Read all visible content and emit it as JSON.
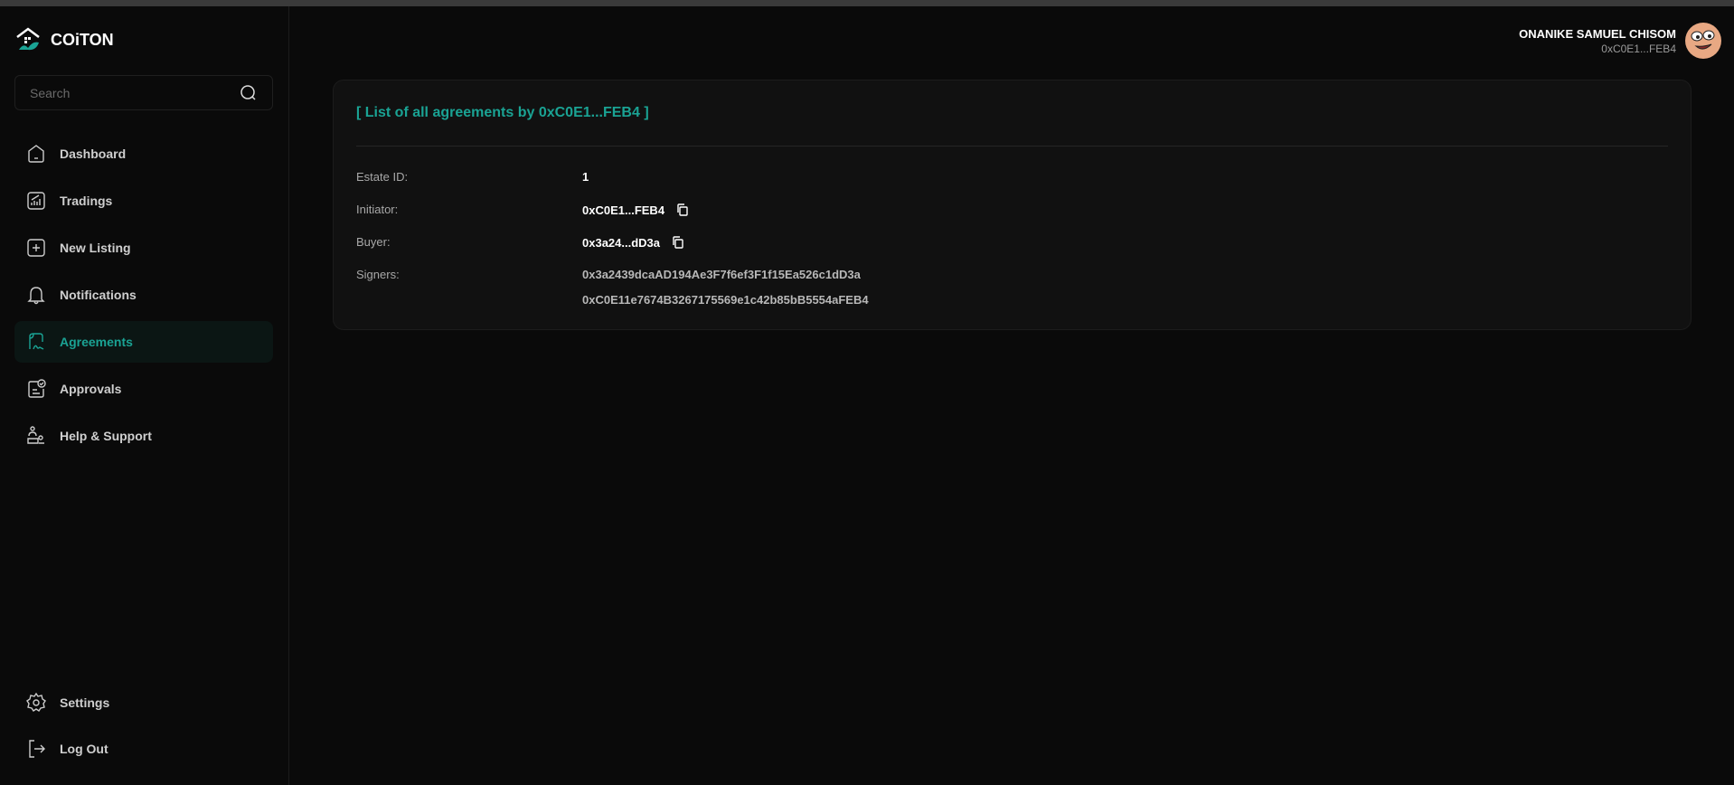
{
  "app": {
    "name": "COiTON"
  },
  "search": {
    "placeholder": "Search"
  },
  "nav": [
    {
      "label": "Dashboard",
      "icon": "home-icon"
    },
    {
      "label": "Tradings",
      "icon": "chart-icon"
    },
    {
      "label": "New Listing",
      "icon": "plus-square-icon"
    },
    {
      "label": "Notifications",
      "icon": "bell-icon"
    },
    {
      "label": "Agreements",
      "icon": "signature-icon",
      "active": true
    },
    {
      "label": "Approvals",
      "icon": "approval-icon"
    },
    {
      "label": "Help & Support",
      "icon": "support-icon"
    }
  ],
  "bottom_nav": [
    {
      "label": "Settings",
      "icon": "gear-icon"
    },
    {
      "label": "Log Out",
      "icon": "logout-icon"
    }
  ],
  "user": {
    "name": "ONANIKE SAMUEL CHISOM",
    "address": "0xC0E1...FEB4"
  },
  "card": {
    "title": "[ List of all agreements by 0xC0E1...FEB4 ]",
    "estate_id_label": "Estate ID:",
    "estate_id": "1",
    "initiator_label": "Initiator:",
    "initiator": "0xC0E1...FEB4",
    "buyer_label": "Buyer:",
    "buyer": "0x3a24...dD3a",
    "signers_label": "Signers:",
    "signers": [
      "0x3a2439dcaAD194Ae3F7f6ef3F1f15Ea526c1dD3a",
      "0xC0E11e7674B3267175569e1c42b85bB5554aFEB4"
    ]
  },
  "colors": {
    "accent": "#1aa394",
    "bg": "#0a0a0a",
    "card": "#111111"
  }
}
